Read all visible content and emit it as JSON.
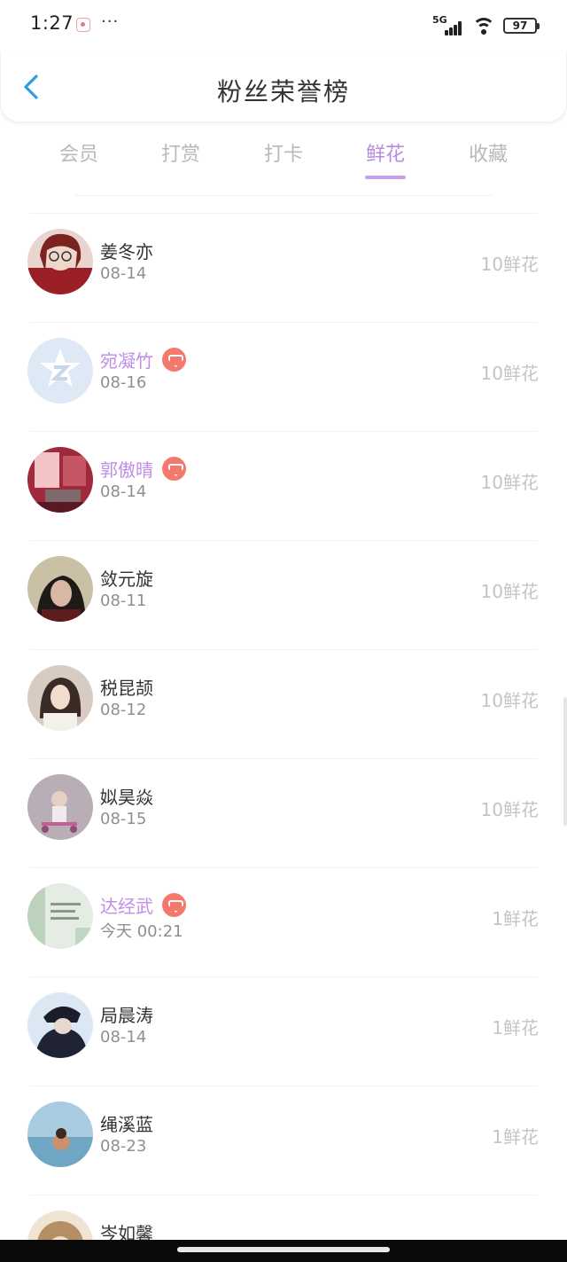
{
  "status_bar": {
    "time": "1:27",
    "more": "···",
    "network": "5G",
    "battery": "97"
  },
  "header": {
    "title": "粉丝荣誉榜"
  },
  "tabs": [
    {
      "label": "会员"
    },
    {
      "label": "打赏"
    },
    {
      "label": "打卡"
    },
    {
      "label": "鲜花",
      "active": true
    },
    {
      "label": "收藏"
    }
  ],
  "colors": {
    "accent": "#b78be0",
    "vip_badge": "#f5786c",
    "back_arrow": "#2f9be3"
  },
  "fans": [
    {
      "name": "姜冬亦",
      "date": "08-14",
      "amount": "10鲜花",
      "vip": false,
      "avatar": "girl-glasses-red"
    },
    {
      "name": "宛凝竹",
      "date": "08-16",
      "amount": "10鲜花",
      "vip": true,
      "avatar": "qzone-default"
    },
    {
      "name": "郭傲晴",
      "date": "08-14",
      "amount": "10鲜花",
      "vip": true,
      "avatar": "pink-room"
    },
    {
      "name": "敛元旋",
      "date": "08-11",
      "amount": "10鲜花",
      "vip": false,
      "avatar": "girl-dark"
    },
    {
      "name": "税昆颉",
      "date": "08-12",
      "amount": "10鲜花",
      "vip": false,
      "avatar": "girl-white"
    },
    {
      "name": "姒昊焱",
      "date": "08-15",
      "amount": "10鲜花",
      "vip": false,
      "avatar": "child-scooter"
    },
    {
      "name": "达经武",
      "date": "今天 00:21",
      "amount": "1鲜花",
      "vip": true,
      "avatar": "text-card"
    },
    {
      "name": "局晨涛",
      "date": "08-14",
      "amount": "1鲜花",
      "vip": false,
      "avatar": "boy-hat"
    },
    {
      "name": "绳溪蓝",
      "date": "08-23",
      "amount": "1鲜花",
      "vip": false,
      "avatar": "sea-figure"
    },
    {
      "name": "岑如馨",
      "date": "",
      "amount": "",
      "vip": false,
      "avatar": "curly-hair"
    }
  ]
}
